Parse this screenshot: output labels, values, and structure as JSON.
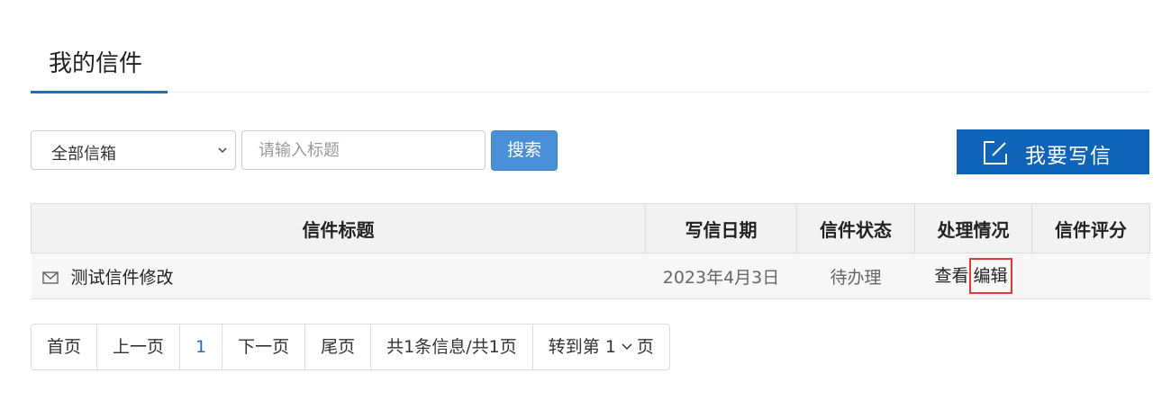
{
  "header": {
    "title": "我的信件"
  },
  "toolbar": {
    "mailbox_select": "全部信箱",
    "search_placeholder": "请输入标题",
    "search_button": "搜索",
    "write_button": "我要写信"
  },
  "table": {
    "headers": [
      "信件标题",
      "写信日期",
      "信件状态",
      "处理情况",
      "信件评分"
    ],
    "rows": [
      {
        "title": "测试信件修改",
        "date": "2023年4月3日",
        "status": "待办理",
        "view": "查看",
        "edit": "编辑",
        "score": ""
      }
    ]
  },
  "pagination": {
    "first": "首页",
    "prev": "上一页",
    "current": "1",
    "next": "下一页",
    "last": "尾页",
    "summary": "共1条信息/共1页",
    "goto_prefix": "转到第",
    "goto_page": "1",
    "goto_suffix": "页"
  },
  "colors": {
    "accent": "#1f6eb7",
    "search_button": "#4a90d9",
    "write_button": "#0f63b8",
    "highlight_border": "#e53935"
  }
}
